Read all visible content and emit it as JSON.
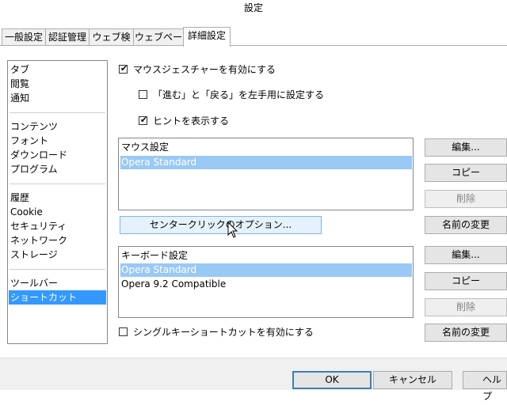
{
  "window": {
    "title": "設定"
  },
  "tabs": [
    {
      "label": "一般設定",
      "active": false
    },
    {
      "label": "認証管理",
      "active": false
    },
    {
      "label": "ウェブ検索",
      "active": false
    },
    {
      "label": "ウェブページ",
      "active": false
    },
    {
      "label": "詳細設定",
      "active": true
    }
  ],
  "sidebar": {
    "items": [
      {
        "label": "タブ"
      },
      {
        "label": "閲覧"
      },
      {
        "label": "通知"
      },
      {
        "label": "コンテンツ"
      },
      {
        "label": "フォント"
      },
      {
        "label": "ダウンロード"
      },
      {
        "label": "プログラム"
      },
      {
        "label": "履歴"
      },
      {
        "label": "Cookie"
      },
      {
        "label": "セキュリティ"
      },
      {
        "label": "ネットワーク"
      },
      {
        "label": "ストレージ"
      },
      {
        "label": "ツールバー"
      },
      {
        "label": "ショートカット",
        "selected": true
      }
    ]
  },
  "mouse": {
    "gestures": {
      "label": "マウスジェスチャーを有効にする",
      "checked": true
    },
    "left_hand": {
      "label": "「進む」と「戻る」を左手用に設定する",
      "checked": false
    },
    "hints": {
      "label": "ヒントを表示する",
      "checked": true
    },
    "list_header": "マウス設定",
    "list_items": [
      "Opera Standard"
    ],
    "center_click_button": "センタークリックのオプション..."
  },
  "keyboard": {
    "list_header": "キーボード設定",
    "list_items": [
      "Opera Standard",
      "Opera 9.2 Compatible"
    ],
    "single_key": {
      "label": "シングルキーショートカットを有効にする",
      "checked": false
    }
  },
  "buttons": {
    "edit": "編集...",
    "copy": "コピー",
    "delete": "削除",
    "rename": "名前の変更"
  },
  "footer": {
    "ok": "OK",
    "cancel": "キャンセル",
    "help": "ヘルプ"
  },
  "icons": {
    "check": "✔",
    "cursor": "arrow-cursor-icon"
  },
  "colors": {
    "selection": "#3399ff",
    "list_selection": "#99c9f5"
  }
}
